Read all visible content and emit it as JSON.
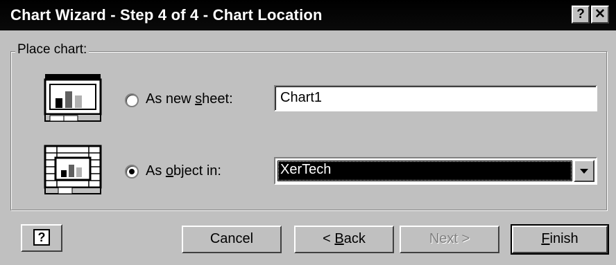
{
  "window": {
    "title": "Chart Wizard - Step 4 of 4 - Chart Location",
    "help_caption": "?",
    "close_caption": "✕"
  },
  "place_chart": {
    "group_label": "Place chart:",
    "new_sheet": {
      "label_prefix": "As new ",
      "label_access": "s",
      "label_suffix": "heet:",
      "selected": false,
      "value": "Chart1"
    },
    "object_in": {
      "label_prefix": "As ",
      "label_access": "o",
      "label_suffix": "bject in:",
      "selected": true,
      "value": "XerTech"
    }
  },
  "buttons": {
    "help": "?",
    "cancel": "Cancel",
    "back_prefix": "< ",
    "back_access": "B",
    "back_suffix": "ack",
    "next": "Next >",
    "finish_access": "F",
    "finish_suffix": "inish"
  },
  "icons": {
    "new_sheet_icon": "chart-sheet-icon",
    "embedded_icon": "embedded-chart-icon"
  }
}
